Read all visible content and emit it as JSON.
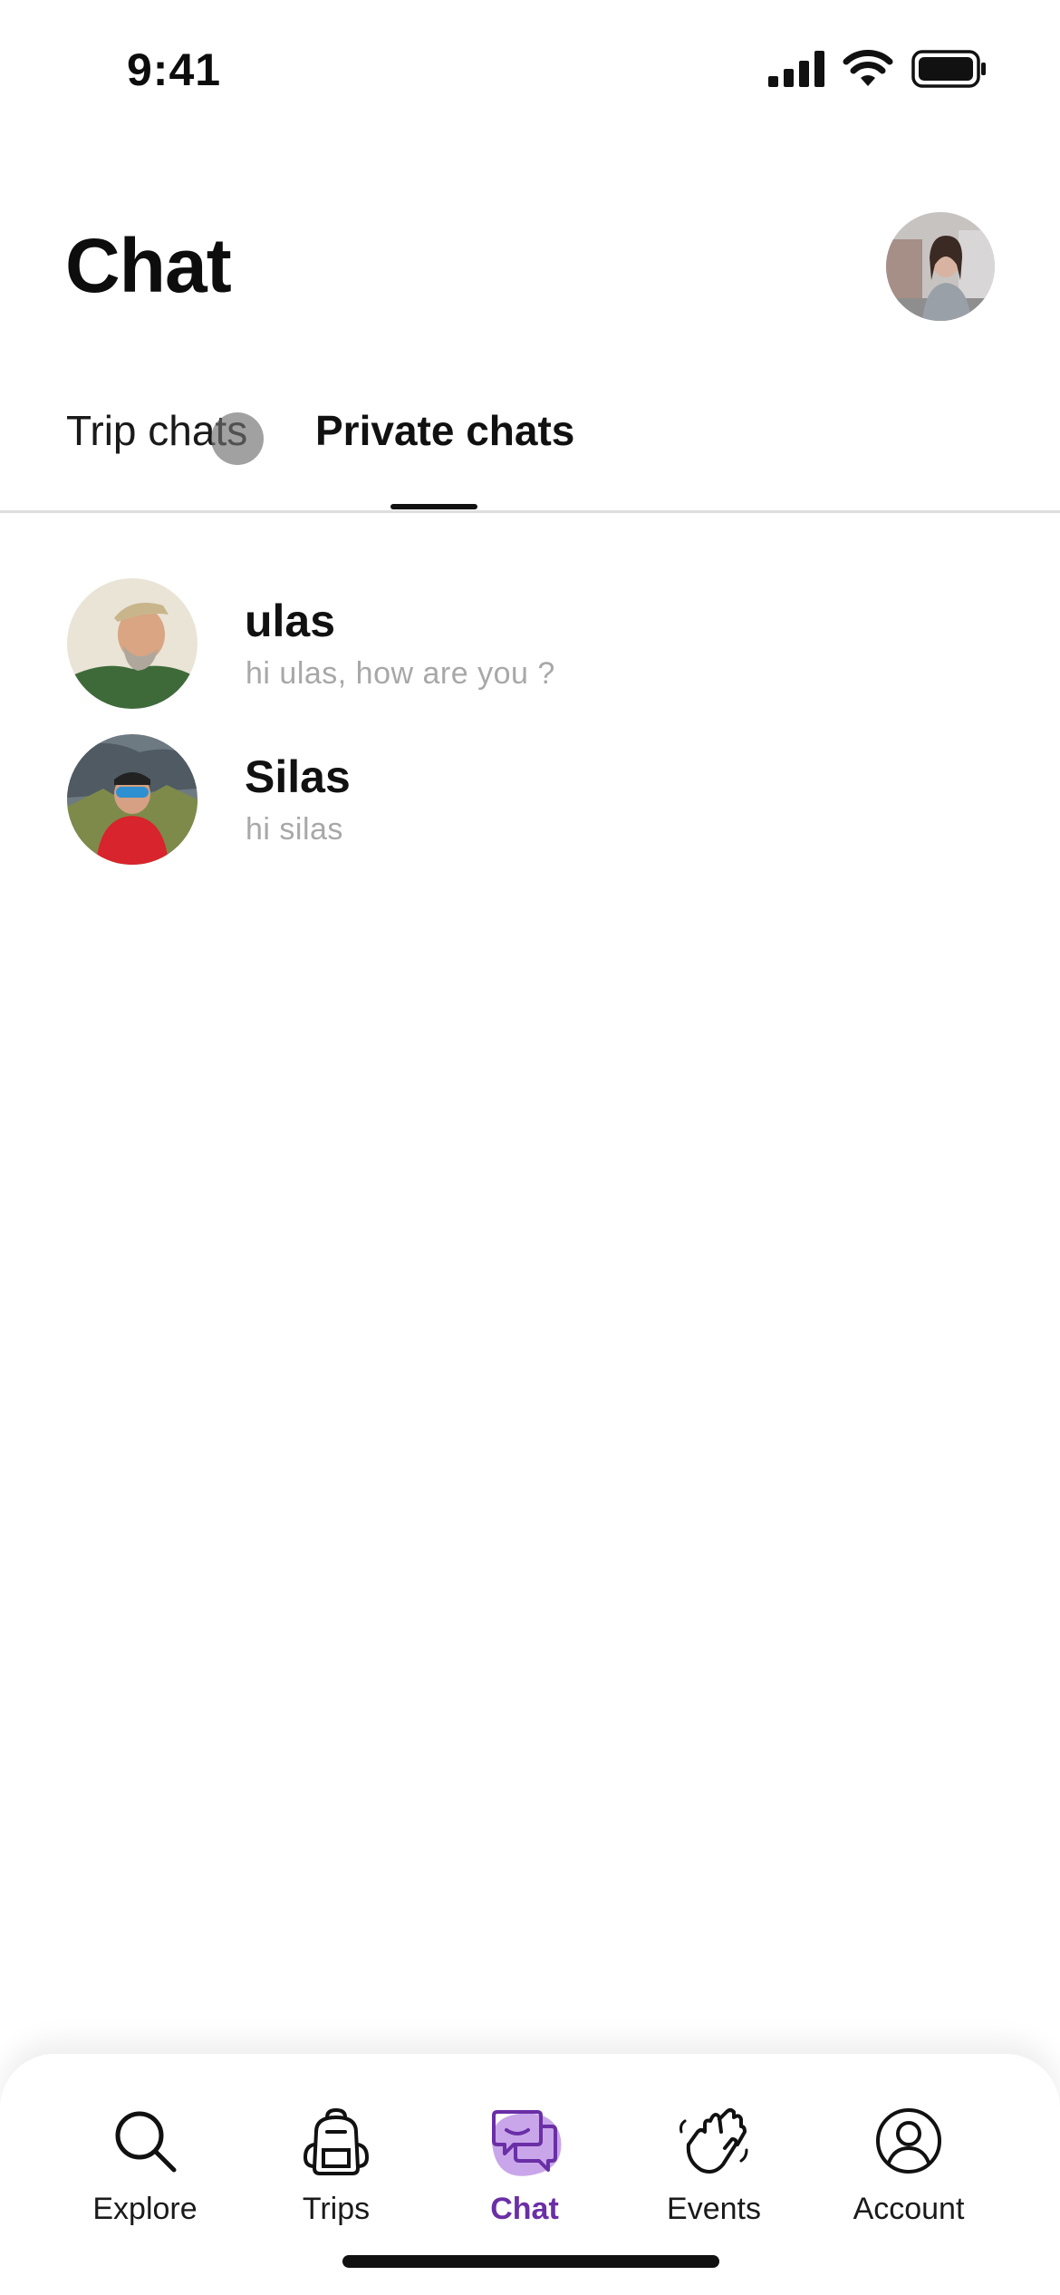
{
  "status_bar": {
    "time": "9:41"
  },
  "header": {
    "title": "Chat"
  },
  "tabs": [
    {
      "label": "Trip chats",
      "active": false
    },
    {
      "label": "Private chats",
      "active": true
    }
  ],
  "chats": [
    {
      "name": "ulas",
      "preview": "hi ulas, how are you ?"
    },
    {
      "name": "Silas",
      "preview": "hi silas"
    }
  ],
  "bottom_nav": [
    {
      "label": "Explore",
      "icon": "search-icon",
      "active": false
    },
    {
      "label": "Trips",
      "icon": "backpack-icon",
      "active": false
    },
    {
      "label": "Chat",
      "icon": "chat-bubbles-icon",
      "active": true
    },
    {
      "label": "Events",
      "icon": "waving-hands-icon",
      "active": false
    },
    {
      "label": "Account",
      "icon": "user-circle-icon",
      "active": false
    }
  ],
  "colors": {
    "accent": "#6a2fa6",
    "accent_light": "#c9a6ea",
    "muted_text": "#a8a8a8"
  }
}
